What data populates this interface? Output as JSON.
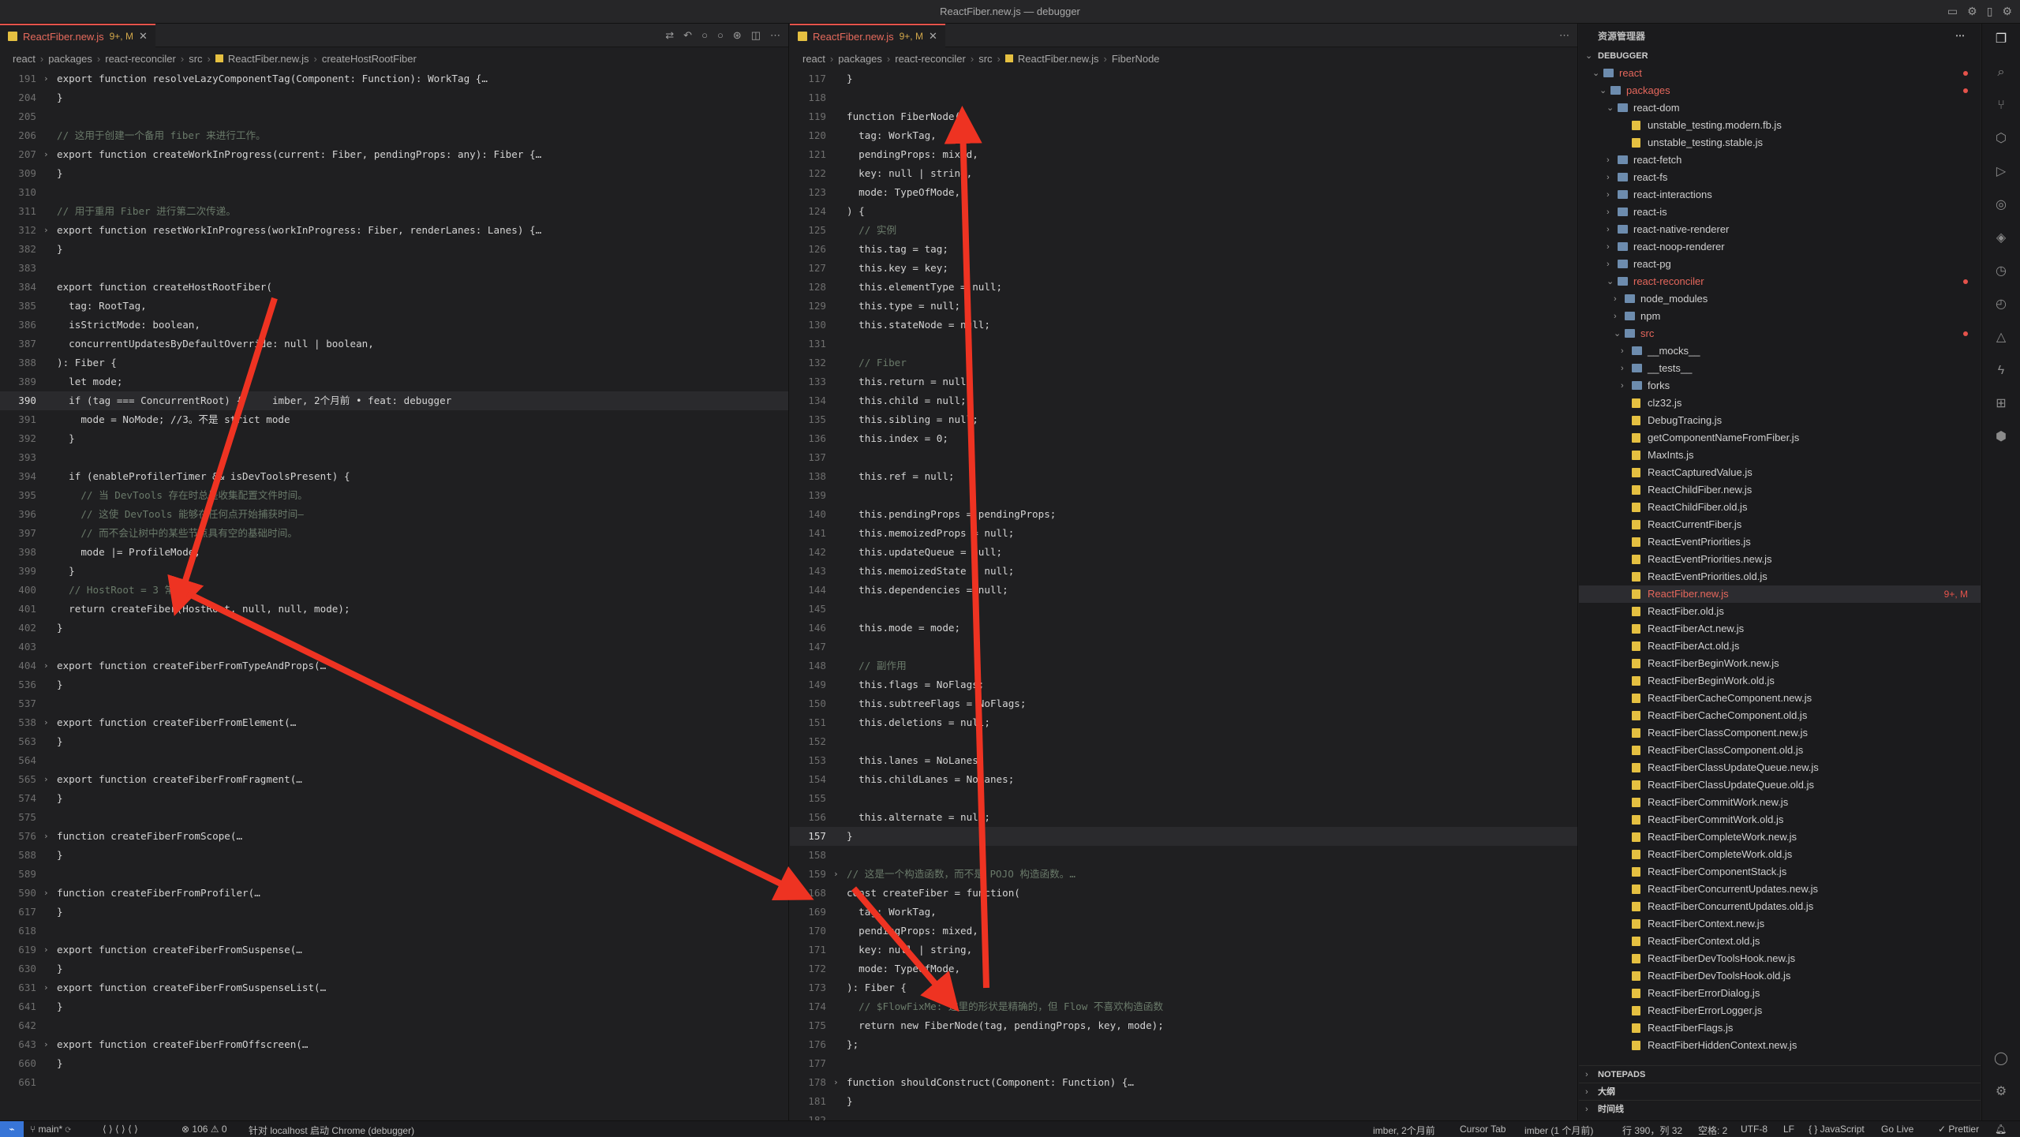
{
  "window": {
    "title": "ReactFiber.new.js — debugger"
  },
  "left_editor": {
    "tab": {
      "name": "ReactFiber.new.js",
      "status": "9+, M"
    },
    "breadcrumb": [
      "react",
      "packages",
      "react-reconciler",
      "src",
      "ReactFiber.new.js",
      "createHostRootFiber"
    ],
    "lines": [
      {
        "n": "191",
        "fold": ">",
        "t": "export function resolveLazyComponentTag(Component: Function): WorkTag {…"
      },
      {
        "n": "204",
        "t": "}"
      },
      {
        "n": "205",
        "t": ""
      },
      {
        "n": "206",
        "t": "// 这用于创建一个备用 fiber 来进行工作。"
      },
      {
        "n": "207",
        "fold": ">",
        "t": "export function createWorkInProgress(current: Fiber, pendingProps: any): Fiber {…"
      },
      {
        "n": "309",
        "t": "}"
      },
      {
        "n": "310",
        "t": ""
      },
      {
        "n": "311",
        "t": "// 用于重用 Fiber 进行第二次传递。"
      },
      {
        "n": "312",
        "fold": ">",
        "t": "export function resetWorkInProgress(workInProgress: Fiber, renderLanes: Lanes) {…"
      },
      {
        "n": "382",
        "t": "}"
      },
      {
        "n": "383",
        "t": ""
      },
      {
        "n": "384",
        "t": "export function createHostRootFiber("
      },
      {
        "n": "385",
        "t": "  tag: RootTag,"
      },
      {
        "n": "386",
        "t": "  isStrictMode: boolean,"
      },
      {
        "n": "387",
        "t": "  concurrentUpdatesByDefaultOverride: null | boolean,"
      },
      {
        "n": "388",
        "t": "): Fiber {"
      },
      {
        "n": "389",
        "t": "  let mode;"
      },
      {
        "n": "390",
        "t": "  if (tag === ConcurrentRoot) {     imber, 2个月前 • feat: debugger"
      },
      {
        "n": "391",
        "t": "    mode = NoMode; //3。不是 strict mode"
      },
      {
        "n": "392",
        "t": "  }"
      },
      {
        "n": "393",
        "t": ""
      },
      {
        "n": "394",
        "t": "  if (enableProfilerTimer && isDevToolsPresent) {"
      },
      {
        "n": "395",
        "t": "    // 当 DevTools 存在时总是收集配置文件时间。"
      },
      {
        "n": "396",
        "t": "    // 这使 DevTools 能够在任何点开始捕获时间—"
      },
      {
        "n": "397",
        "t": "    // 而不会让树中的某些节点具有空的基础时间。"
      },
      {
        "n": "398",
        "t": "    mode |= ProfileMode;"
      },
      {
        "n": "399",
        "t": "  }"
      },
      {
        "n": "400",
        "t": "  // HostRoot = 3 常量"
      },
      {
        "n": "401",
        "t": "  return createFiber(HostRoot, null, null, mode);"
      },
      {
        "n": "402",
        "t": "}"
      },
      {
        "n": "403",
        "t": ""
      },
      {
        "n": "404",
        "fold": ">",
        "t": "export function createFiberFromTypeAndProps(…"
      },
      {
        "n": "536",
        "t": "}"
      },
      {
        "n": "537",
        "t": ""
      },
      {
        "n": "538",
        "fold": ">",
        "t": "export function createFiberFromElement(…"
      },
      {
        "n": "563",
        "t": "}"
      },
      {
        "n": "564",
        "t": ""
      },
      {
        "n": "565",
        "fold": ">",
        "t": "export function createFiberFromFragment(…"
      },
      {
        "n": "574",
        "t": "}"
      },
      {
        "n": "575",
        "t": ""
      },
      {
        "n": "576",
        "fold": ">",
        "t": "function createFiberFromScope(…"
      },
      {
        "n": "588",
        "t": "}"
      },
      {
        "n": "589",
        "t": ""
      },
      {
        "n": "590",
        "fold": ">",
        "t": "function createFiberFromProfiler(…"
      },
      {
        "n": "617",
        "t": "}"
      },
      {
        "n": "618",
        "t": ""
      },
      {
        "n": "619",
        "fold": ">",
        "t": "export function createFiberFromSuspense(…"
      },
      {
        "n": "630",
        "t": "}"
      },
      {
        "n": "631",
        "fold": ">",
        "t": "export function createFiberFromSuspenseList(…"
      },
      {
        "n": "641",
        "t": "}"
      },
      {
        "n": "642",
        "t": ""
      },
      {
        "n": "643",
        "fold": ">",
        "t": "export function createFiberFromOffscreen(…"
      },
      {
        "n": "660",
        "t": "}"
      },
      {
        "n": "661",
        "t": ""
      }
    ]
  },
  "right_editor": {
    "tab": {
      "name": "ReactFiber.new.js",
      "status": "9+, M"
    },
    "breadcrumb": [
      "react",
      "packages",
      "react-reconciler",
      "src",
      "ReactFiber.new.js",
      "FiberNode"
    ],
    "lines": [
      {
        "n": "117",
        "t": "}"
      },
      {
        "n": "118",
        "t": ""
      },
      {
        "n": "119",
        "t": "function FiberNode("
      },
      {
        "n": "120",
        "t": "  tag: WorkTag,"
      },
      {
        "n": "121",
        "t": "  pendingProps: mixed,"
      },
      {
        "n": "122",
        "t": "  key: null | string,"
      },
      {
        "n": "123",
        "t": "  mode: TypeOfMode,"
      },
      {
        "n": "124",
        "t": ") {"
      },
      {
        "n": "125",
        "t": "  // 实例"
      },
      {
        "n": "126",
        "t": "  this.tag = tag;"
      },
      {
        "n": "127",
        "t": "  this.key = key;"
      },
      {
        "n": "128",
        "t": "  this.elementType = null;"
      },
      {
        "n": "129",
        "t": "  this.type = null;"
      },
      {
        "n": "130",
        "t": "  this.stateNode = null;"
      },
      {
        "n": "131",
        "t": ""
      },
      {
        "n": "132",
        "t": "  // Fiber"
      },
      {
        "n": "133",
        "t": "  this.return = null;"
      },
      {
        "n": "134",
        "t": "  this.child = null;"
      },
      {
        "n": "135",
        "t": "  this.sibling = null;"
      },
      {
        "n": "136",
        "t": "  this.index = 0;"
      },
      {
        "n": "137",
        "t": ""
      },
      {
        "n": "138",
        "t": "  this.ref = null;"
      },
      {
        "n": "139",
        "t": ""
      },
      {
        "n": "140",
        "t": "  this.pendingProps = pendingProps;"
      },
      {
        "n": "141",
        "t": "  this.memoizedProps = null;"
      },
      {
        "n": "142",
        "t": "  this.updateQueue = null;"
      },
      {
        "n": "143",
        "t": "  this.memoizedState = null;"
      },
      {
        "n": "144",
        "t": "  this.dependencies = null;"
      },
      {
        "n": "145",
        "t": ""
      },
      {
        "n": "146",
        "t": "  this.mode = mode;"
      },
      {
        "n": "147",
        "t": ""
      },
      {
        "n": "148",
        "t": "  // 副作用"
      },
      {
        "n": "149",
        "t": "  this.flags = NoFlags;"
      },
      {
        "n": "150",
        "t": "  this.subtreeFlags = NoFlags;"
      },
      {
        "n": "151",
        "t": "  this.deletions = null;"
      },
      {
        "n": "152",
        "t": ""
      },
      {
        "n": "153",
        "t": "  this.lanes = NoLanes;"
      },
      {
        "n": "154",
        "t": "  this.childLanes = NoLanes;"
      },
      {
        "n": "155",
        "t": ""
      },
      {
        "n": "156",
        "t": "  this.alternate = null;"
      },
      {
        "n": "157",
        "t": "}"
      },
      {
        "n": "158",
        "t": ""
      },
      {
        "n": "159",
        "fold": ">",
        "t": "// 这是一个构造函数，而不是 POJO 构造函数。…"
      },
      {
        "n": "168",
        "t": "const createFiber = function("
      },
      {
        "n": "169",
        "t": "  tag: WorkTag,"
      },
      {
        "n": "170",
        "t": "  pendingProps: mixed,"
      },
      {
        "n": "171",
        "t": "  key: null | string,"
      },
      {
        "n": "172",
        "t": "  mode: TypeOfMode,"
      },
      {
        "n": "173",
        "t": "): Fiber {"
      },
      {
        "n": "174",
        "t": "  // $FlowFixMe: 这里的形状是精确的，但 Flow 不喜欢构造函数"
      },
      {
        "n": "175",
        "t": "  return new FiberNode(tag, pendingProps, key, mode);"
      },
      {
        "n": "176",
        "t": "};"
      },
      {
        "n": "177",
        "t": ""
      },
      {
        "n": "178",
        "fold": ">",
        "t": "function shouldConstruct(Component: Function) {…"
      },
      {
        "n": "181",
        "t": "}"
      },
      {
        "n": "182",
        "t": ""
      }
    ]
  },
  "explorer": {
    "title": "资源管理器",
    "section": "DEBUGGER",
    "items": [
      {
        "label": "react",
        "depth": 1,
        "type": "folder",
        "open": true,
        "color": "red",
        "dot": true
      },
      {
        "label": "packages",
        "depth": 2,
        "type": "folder",
        "open": true,
        "color": "red",
        "dot": true
      },
      {
        "label": "react-dom",
        "depth": 3,
        "type": "folder",
        "open": true
      },
      {
        "label": "unstable_testing.modern.fb.js",
        "depth": 5,
        "type": "file"
      },
      {
        "label": "unstable_testing.stable.js",
        "depth": 5,
        "type": "file"
      },
      {
        "label": "react-fetch",
        "depth": 3,
        "type": "folder"
      },
      {
        "label": "react-fs",
        "depth": 3,
        "type": "folder"
      },
      {
        "label": "react-interactions",
        "depth": 3,
        "type": "folder"
      },
      {
        "label": "react-is",
        "depth": 3,
        "type": "folder"
      },
      {
        "label": "react-native-renderer",
        "depth": 3,
        "type": "folder"
      },
      {
        "label": "react-noop-renderer",
        "depth": 3,
        "type": "folder"
      },
      {
        "label": "react-pg",
        "depth": 3,
        "type": "folder"
      },
      {
        "label": "react-reconciler",
        "depth": 3,
        "type": "folder",
        "open": true,
        "color": "red",
        "dot": true
      },
      {
        "label": "node_modules",
        "depth": 4,
        "type": "folder"
      },
      {
        "label": "npm",
        "depth": 4,
        "type": "folder"
      },
      {
        "label": "src",
        "depth": 4,
        "type": "folder",
        "open": true,
        "color": "red",
        "dot": true
      },
      {
        "label": "__mocks__",
        "depth": 5,
        "type": "folder"
      },
      {
        "label": "__tests__",
        "depth": 5,
        "type": "folder"
      },
      {
        "label": "forks",
        "depth": 5,
        "type": "folder"
      },
      {
        "label": "clz32.js",
        "depth": 5,
        "type": "file"
      },
      {
        "label": "DebugTracing.js",
        "depth": 5,
        "type": "file"
      },
      {
        "label": "getComponentNameFromFiber.js",
        "depth": 5,
        "type": "file"
      },
      {
        "label": "MaxInts.js",
        "depth": 5,
        "type": "file"
      },
      {
        "label": "ReactCapturedValue.js",
        "depth": 5,
        "type": "file"
      },
      {
        "label": "ReactChildFiber.new.js",
        "depth": 5,
        "type": "file"
      },
      {
        "label": "ReactChildFiber.old.js",
        "depth": 5,
        "type": "file"
      },
      {
        "label": "ReactCurrentFiber.js",
        "depth": 5,
        "type": "file"
      },
      {
        "label": "ReactEventPriorities.js",
        "depth": 5,
        "type": "file"
      },
      {
        "label": "ReactEventPriorities.new.js",
        "depth": 5,
        "type": "file"
      },
      {
        "label": "ReactEventPriorities.old.js",
        "depth": 5,
        "type": "file"
      },
      {
        "label": "ReactFiber.new.js",
        "depth": 5,
        "type": "file",
        "selected": true,
        "color": "red",
        "badge": "9+, M"
      },
      {
        "label": "ReactFiber.old.js",
        "depth": 5,
        "type": "file"
      },
      {
        "label": "ReactFiberAct.new.js",
        "depth": 5,
        "type": "file"
      },
      {
        "label": "ReactFiberAct.old.js",
        "depth": 5,
        "type": "file"
      },
      {
        "label": "ReactFiberBeginWork.new.js",
        "depth": 5,
        "type": "file"
      },
      {
        "label": "ReactFiberBeginWork.old.js",
        "depth": 5,
        "type": "file"
      },
      {
        "label": "ReactFiberCacheComponent.new.js",
        "depth": 5,
        "type": "file"
      },
      {
        "label": "ReactFiberCacheComponent.old.js",
        "depth": 5,
        "type": "file"
      },
      {
        "label": "ReactFiberClassComponent.new.js",
        "depth": 5,
        "type": "file"
      },
      {
        "label": "ReactFiberClassComponent.old.js",
        "depth": 5,
        "type": "file"
      },
      {
        "label": "ReactFiberClassUpdateQueue.new.js",
        "depth": 5,
        "type": "file"
      },
      {
        "label": "ReactFiberClassUpdateQueue.old.js",
        "depth": 5,
        "type": "file"
      },
      {
        "label": "ReactFiberCommitWork.new.js",
        "depth": 5,
        "type": "file"
      },
      {
        "label": "ReactFiberCommitWork.old.js",
        "depth": 5,
        "type": "file"
      },
      {
        "label": "ReactFiberCompleteWork.new.js",
        "depth": 5,
        "type": "file"
      },
      {
        "label": "ReactFiberCompleteWork.old.js",
        "depth": 5,
        "type": "file"
      },
      {
        "label": "ReactFiberComponentStack.js",
        "depth": 5,
        "type": "file"
      },
      {
        "label": "ReactFiberConcurrentUpdates.new.js",
        "depth": 5,
        "type": "file"
      },
      {
        "label": "ReactFiberConcurrentUpdates.old.js",
        "depth": 5,
        "type": "file"
      },
      {
        "label": "ReactFiberContext.new.js",
        "depth": 5,
        "type": "file"
      },
      {
        "label": "ReactFiberContext.old.js",
        "depth": 5,
        "type": "file"
      },
      {
        "label": "ReactFiberDevToolsHook.new.js",
        "depth": 5,
        "type": "file"
      },
      {
        "label": "ReactFiberDevToolsHook.old.js",
        "depth": 5,
        "type": "file"
      },
      {
        "label": "ReactFiberErrorDialog.js",
        "depth": 5,
        "type": "file"
      },
      {
        "label": "ReactFiberErrorLogger.js",
        "depth": 5,
        "type": "file"
      },
      {
        "label": "ReactFiberFlags.js",
        "depth": 5,
        "type": "file"
      },
      {
        "label": "ReactFiberHiddenContext.new.js",
        "depth": 5,
        "type": "file"
      }
    ],
    "bottom_sections": [
      "NOTEPADS",
      "大纲",
      "时间线"
    ]
  },
  "statusbar": {
    "branch": "main*",
    "problems": "⊗ 106 ⚠ 0",
    "launch": "针对 localhost 启动 Chrome (debugger)",
    "blame": "imber, 2个月前",
    "cursor_tab": "Cursor Tab",
    "author": "imber (1 个月前)",
    "position": "行 390，列 32",
    "spaces": "空格: 2",
    "encoding": "UTF-8",
    "eol": "LF",
    "language": "{ } JavaScript",
    "golive": "Go Live",
    "prettier": "✓ Prettier"
  },
  "colors": {
    "accent": "#e5534b",
    "arrow": "#ee3322",
    "status_remote": "#3875d7"
  }
}
